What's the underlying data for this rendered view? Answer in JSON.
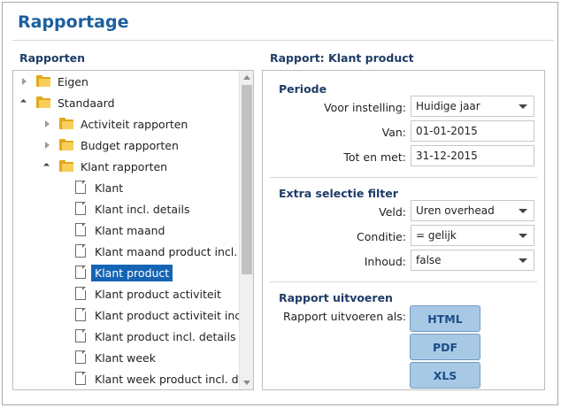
{
  "page": {
    "title": "Rapportage"
  },
  "left": {
    "heading": "Rapporten",
    "tree": [
      {
        "label": "Eigen",
        "kind": "folder",
        "state": "collapsed",
        "depth": 0
      },
      {
        "label": "Standaard",
        "kind": "folder",
        "state": "expanded",
        "depth": 0
      },
      {
        "label": "Activiteit rapporten",
        "kind": "folder",
        "state": "collapsed",
        "depth": 1
      },
      {
        "label": "Budget rapporten",
        "kind": "folder",
        "state": "collapsed",
        "depth": 1
      },
      {
        "label": "Klant rapporten",
        "kind": "folder",
        "state": "expanded",
        "depth": 1
      },
      {
        "label": "Klant",
        "kind": "doc",
        "depth": 2
      },
      {
        "label": "Klant incl. details",
        "kind": "doc",
        "depth": 2
      },
      {
        "label": "Klant maand",
        "kind": "doc",
        "depth": 2
      },
      {
        "label": "Klant maand product incl. de",
        "kind": "doc",
        "depth": 2
      },
      {
        "label": "Klant product",
        "kind": "doc",
        "depth": 2,
        "selected": true
      },
      {
        "label": "Klant product activiteit",
        "kind": "doc",
        "depth": 2
      },
      {
        "label": "Klant product activiteit incl. d",
        "kind": "doc",
        "depth": 2
      },
      {
        "label": "Klant product incl. details",
        "kind": "doc",
        "depth": 2
      },
      {
        "label": "Klant week",
        "kind": "doc",
        "depth": 2
      },
      {
        "label": "Klant week product incl. deta",
        "kind": "doc",
        "depth": 2
      }
    ]
  },
  "right": {
    "heading": "Rapport: Klant product",
    "periode": {
      "heading": "Periode",
      "preset_label": "Voor instelling:",
      "preset_value": "Huidige jaar",
      "from_label": "Van:",
      "from_value": "01-01-2015",
      "to_label": "Tot en met:",
      "to_value": "31-12-2015"
    },
    "filter": {
      "heading": "Extra selectie filter",
      "field_label": "Veld:",
      "field_value": "Uren overhead",
      "condition_label": "Conditie:",
      "condition_value": "= gelijk",
      "content_label": "Inhoud:",
      "content_value": "false"
    },
    "run": {
      "heading": "Rapport uitvoeren",
      "as_label": "Rapport uitvoeren als:",
      "buttons": [
        "HTML",
        "PDF",
        "XLS"
      ]
    }
  },
  "colors": {
    "title_blue": "#1b5f9e",
    "heading_navy": "#1f3c66",
    "selection_blue": "#1665b5",
    "button_fill": "#a8c9e6",
    "folder_yellow": "#f7cf5a"
  }
}
